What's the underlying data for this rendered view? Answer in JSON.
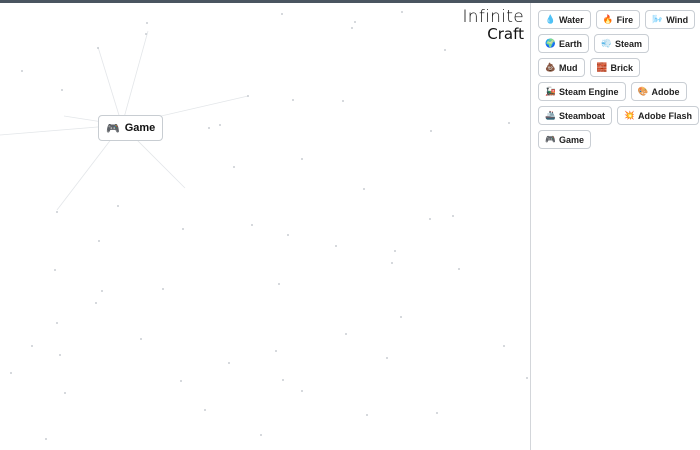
{
  "logo": {
    "line1": "Infinite",
    "line2": "Craft"
  },
  "canvas": {
    "node": {
      "emoji": "🎮",
      "label": "Game",
      "icon": "gamepad-icon"
    }
  },
  "sidebar": {
    "items": [
      {
        "emoji": "💧",
        "label": "Water",
        "icon": "water-drop-icon"
      },
      {
        "emoji": "🔥",
        "label": "Fire",
        "icon": "fire-icon"
      },
      {
        "emoji": "🌬️",
        "label": "Wind",
        "icon": "wind-icon"
      },
      {
        "emoji": "🌍",
        "label": "Earth",
        "icon": "globe-icon"
      },
      {
        "emoji": "💨",
        "label": "Steam",
        "icon": "steam-cloud-icon"
      },
      {
        "emoji": "💩",
        "label": "Mud",
        "icon": "mud-icon"
      },
      {
        "emoji": "🧱",
        "label": "Brick",
        "icon": "brick-icon"
      },
      {
        "emoji": "🚂",
        "label": "Steam Engine",
        "icon": "locomotive-icon"
      },
      {
        "emoji": "🎨",
        "label": "Adobe",
        "icon": "palette-icon"
      },
      {
        "emoji": "🚢",
        "label": "Steamboat",
        "icon": "ship-icon"
      },
      {
        "emoji": "💥",
        "label": "Adobe Flash",
        "icon": "flash-burst-icon"
      },
      {
        "emoji": "🎮",
        "label": "Game",
        "icon": "gamepad-icon"
      }
    ]
  }
}
